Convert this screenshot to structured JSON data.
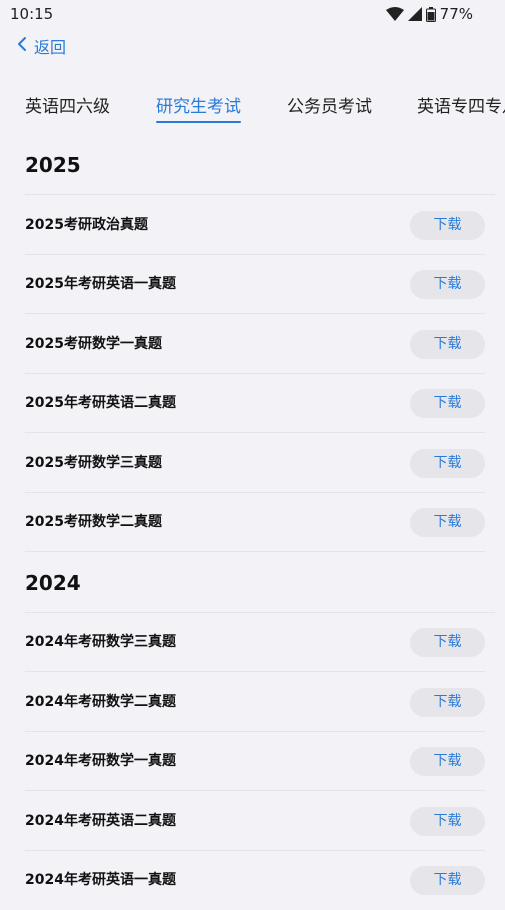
{
  "status": {
    "time": "10:15",
    "battery": "77%"
  },
  "nav": {
    "back_label": "返回"
  },
  "tabs": [
    {
      "label": "英语四六级",
      "active": false
    },
    {
      "label": "研究生考试",
      "active": true
    },
    {
      "label": "公务员考试",
      "active": false
    },
    {
      "label": "英语专四专八",
      "active": false
    }
  ],
  "sections": [
    {
      "year": "2025",
      "items": [
        {
          "title": "2025考研政治真题",
          "button": "下载"
        },
        {
          "title": "2025年考研英语一真题",
          "button": "下载"
        },
        {
          "title": "2025考研数学一真题",
          "button": "下载"
        },
        {
          "title": "2025年考研英语二真题",
          "button": "下载"
        },
        {
          "title": "2025考研数学三真题",
          "button": "下载"
        },
        {
          "title": "2025考研数学二真题",
          "button": "下载"
        }
      ]
    },
    {
      "year": "2024",
      "items": [
        {
          "title": "2024年考研数学三真题",
          "button": "下载"
        },
        {
          "title": "2024年考研数学二真题",
          "button": "下载"
        },
        {
          "title": "2024年考研数学一真题",
          "button": "下载"
        },
        {
          "title": "2024年考研英语二真题",
          "button": "下载"
        },
        {
          "title": "2024年考研英语一真题",
          "button": "下载"
        }
      ]
    }
  ]
}
